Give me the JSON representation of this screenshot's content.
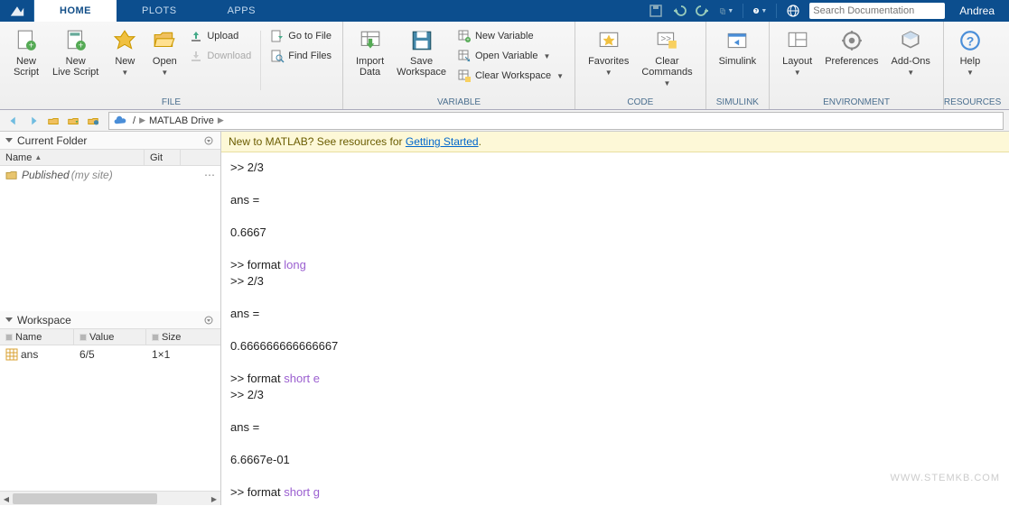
{
  "titlebar": {
    "tabs": [
      {
        "label": "HOME",
        "active": true
      },
      {
        "label": "PLOTS",
        "active": false
      },
      {
        "label": "APPS",
        "active": false
      }
    ],
    "search_placeholder": "Search Documentation",
    "username": "Andrea"
  },
  "toolstrip": {
    "groups": {
      "file": {
        "label": "FILE",
        "new_script": "New\nScript",
        "new_live_script": "New\nLive Script",
        "new": "New",
        "open": "Open",
        "upload": "Upload",
        "download": "Download",
        "goto_file": "Go to File",
        "find_files": "Find Files"
      },
      "variable": {
        "label": "VARIABLE",
        "import_data": "Import\nData",
        "save_workspace": "Save\nWorkspace",
        "new_variable": "New Variable",
        "open_variable": "Open Variable",
        "clear_workspace": "Clear Workspace"
      },
      "code": {
        "label": "CODE",
        "favorites": "Favorites",
        "clear_commands": "Clear\nCommands"
      },
      "simulink": {
        "label": "SIMULINK",
        "simulink": "Simulink"
      },
      "environment": {
        "label": "ENVIRONMENT",
        "layout": "Layout",
        "preferences": "Preferences",
        "addons": "Add-Ons"
      },
      "resources": {
        "label": "RESOURCES",
        "help": "Help"
      }
    }
  },
  "address": {
    "segments": [
      "MATLAB Drive"
    ]
  },
  "panels": {
    "current_folder": {
      "title": "Current Folder",
      "columns": {
        "name": "Name",
        "git": "Git"
      },
      "rows": [
        {
          "name": "Published",
          "comment": "(my site)"
        }
      ]
    },
    "workspace": {
      "title": "Workspace",
      "columns": {
        "name": "Name",
        "value": "Value",
        "size": "Size"
      },
      "rows": [
        {
          "name": "ans",
          "value": "6/5",
          "size": "1×1"
        }
      ]
    }
  },
  "banner": {
    "prefix": "New to MATLAB? See resources for ",
    "link": "Getting Started",
    "suffix": "."
  },
  "command_window": {
    "lines": [
      {
        "t": ">> 2/3"
      },
      {
        "t": ""
      },
      {
        "t": "ans ="
      },
      {
        "t": ""
      },
      {
        "t": "    0.6667"
      },
      {
        "t": ""
      },
      {
        "t": ">> format ",
        "kw": "long"
      },
      {
        "t": ">> 2/3"
      },
      {
        "t": ""
      },
      {
        "t": "ans ="
      },
      {
        "t": ""
      },
      {
        "t": "   0.666666666666667"
      },
      {
        "t": ""
      },
      {
        "t": ">> format ",
        "kw": "short e"
      },
      {
        "t": ">> 2/3"
      },
      {
        "t": ""
      },
      {
        "t": "ans ="
      },
      {
        "t": ""
      },
      {
        "t": "   6.6667e-01"
      },
      {
        "t": ""
      },
      {
        "t": ">> format ",
        "kw": "short g"
      }
    ]
  },
  "watermark": "WWW.STEMKB.COM"
}
